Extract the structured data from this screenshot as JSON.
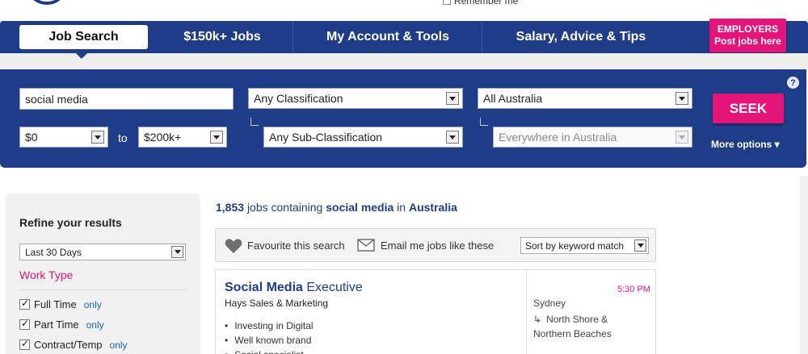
{
  "top": {
    "remember_label": "Remember me"
  },
  "nav": {
    "tabs": [
      {
        "label": "Job Search"
      },
      {
        "label": "$150k+ Jobs"
      },
      {
        "label": "My Account & Tools"
      },
      {
        "label": "Salary, Advice & Tips"
      }
    ],
    "employers_line1": "EMPLOYERS",
    "employers_line2": "Post jobs here"
  },
  "search": {
    "keywords": "social media",
    "classification": "Any Classification",
    "location": "All Australia",
    "salary_min": "$0",
    "salary_to": "to",
    "salary_max": "$200k+",
    "sub_classification": "Any Sub-Classification",
    "sub_location": "Everywhere in Australia",
    "seek_label": "SEEK",
    "more_options": "More options ▾",
    "help": "?"
  },
  "refine": {
    "title": "Refine your results",
    "date_filter": "Last 30 Days",
    "work_type_heading": "Work Type",
    "work_types": [
      {
        "label": "Full Time",
        "only": "only"
      },
      {
        "label": "Part Time",
        "only": "only"
      },
      {
        "label": "Contract/Temp",
        "only": "only"
      }
    ]
  },
  "results": {
    "count": "1,853",
    "text_jobs_containing": "jobs containing",
    "keyword": "social media",
    "text_in": "in",
    "location": "Australia"
  },
  "toolbar": {
    "favourite_label": "Favourite this search",
    "email_label": "Email me jobs like these",
    "sort_value": "Sort by keyword match"
  },
  "job": {
    "title_bold": "Social Media",
    "title_rest": "Executive",
    "company": "Hays Sales & Marketing",
    "bullets": [
      "Investing in Digital",
      "Well known brand",
      "Social specialist"
    ],
    "time": "5:30 PM",
    "location": "Sydney",
    "area_arrow": "↳",
    "area_line1": "North Shore &",
    "area_line2": "Northern Beaches"
  },
  "colors": {
    "navy": "#1f3c88",
    "pink": "#e3157a"
  }
}
